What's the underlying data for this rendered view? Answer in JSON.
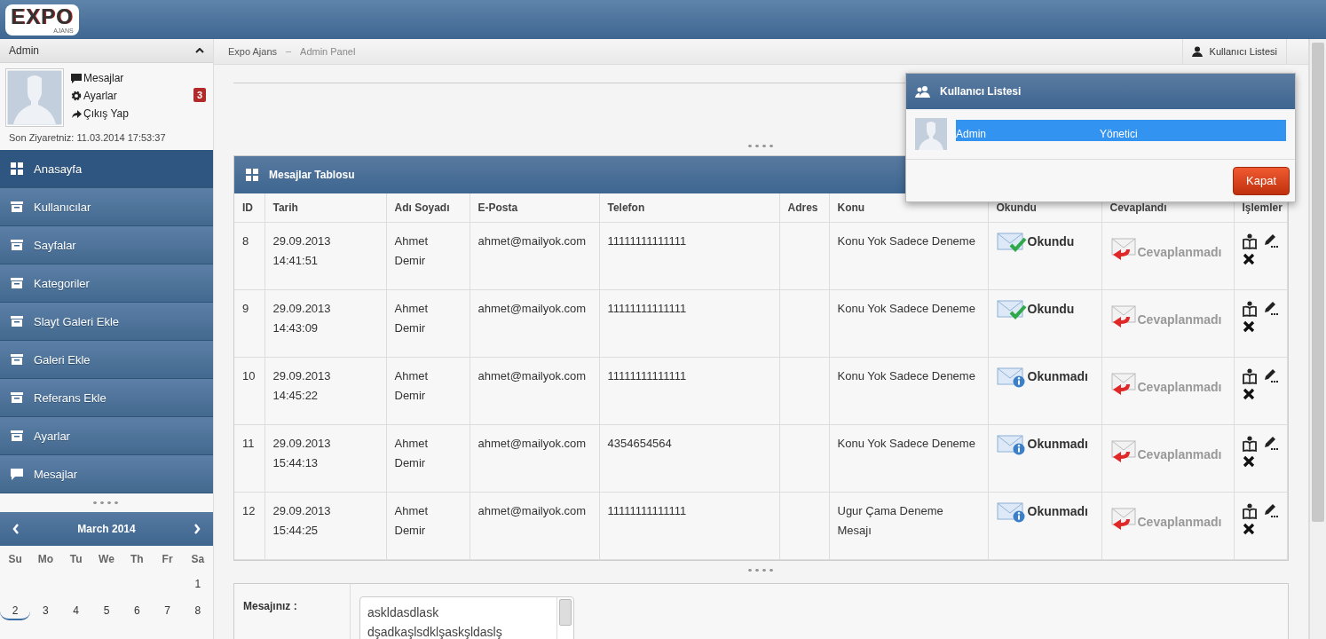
{
  "header": {
    "logo": "EXPO",
    "logo_sub": "AJANS"
  },
  "profile": {
    "title": "Admin",
    "links": [
      {
        "kind": "message",
        "label": "Mesajlar"
      },
      {
        "kind": "settings",
        "label": "Ayarlar"
      },
      {
        "kind": "logout",
        "label": "Çıkış Yap"
      }
    ],
    "badge": "3",
    "last_visit": "Son Ziyaretniz: 11.03.2014 17:53:37"
  },
  "sidebar": {
    "items": [
      {
        "label": "Anasayfa",
        "kind": "dashboard",
        "selected": true
      },
      {
        "label": "Kullanıcılar",
        "kind": "section",
        "selected": false
      },
      {
        "label": "Sayfalar",
        "kind": "section",
        "selected": false
      },
      {
        "label": "Kategoriler",
        "kind": "section",
        "selected": false
      },
      {
        "label": "Slayt Galeri Ekle",
        "kind": "section",
        "selected": false
      },
      {
        "label": "Galeri Ekle",
        "kind": "section",
        "selected": false
      },
      {
        "label": "Referans Ekle",
        "kind": "section",
        "selected": false
      },
      {
        "label": "Ayarlar",
        "kind": "section",
        "selected": false
      },
      {
        "label": "Mesajlar",
        "kind": "message",
        "selected": false
      }
    ]
  },
  "calendar": {
    "title": "March 2014",
    "weekdays": [
      "Su",
      "Mo",
      "Tu",
      "We",
      "Th",
      "Fr",
      "Sa"
    ],
    "weeks": [
      [
        {
          "day": "1",
          "selected": false
        }
      ],
      [
        {
          "day": "2",
          "selected": true
        },
        {
          "day": "3",
          "selected": false
        },
        {
          "day": "4",
          "selected": false
        },
        {
          "day": "5",
          "selected": false
        },
        {
          "day": "6",
          "selected": false
        },
        {
          "day": "7",
          "selected": false
        },
        {
          "day": "8",
          "selected": false
        }
      ]
    ]
  },
  "breadcrumb": [
    "Expo Ajans",
    "Admin Panel"
  ],
  "user_list_button": "Kullanıcı Listesi",
  "table": {
    "title": "Mesajlar Tablosu",
    "columns": [
      "ID",
      "Tarih",
      "Adı Soyadı",
      "E-Posta",
      "Telefon",
      "Adres",
      "Konu",
      "Okundu",
      "Cevaplandı",
      "İşlemler"
    ],
    "rows": [
      {
        "id": "8",
        "date": "29.09.2013",
        "time": "14:41:51",
        "name": "Ahmet Demir",
        "email": "ahmet@mailyok.com",
        "phone": "11111111111111",
        "subject": "Konu Yok Sadece Deneme",
        "read": true,
        "read_label": "Okundu",
        "answered": false,
        "answer_label": "Cevaplanmadı"
      },
      {
        "id": "9",
        "date": "29.09.2013",
        "time": "14:43:09",
        "name": "Ahmet Demir",
        "email": "ahmet@mailyok.com",
        "phone": "11111111111111",
        "subject": "Konu Yok Sadece Deneme",
        "read": true,
        "read_label": "Okundu",
        "answered": false,
        "answer_label": "Cevaplanmadı"
      },
      {
        "id": "10",
        "date": "29.09.2013",
        "time": "14:45:22",
        "name": "Ahmet Demir",
        "email": "ahmet@mailyok.com",
        "phone": "11111111111111",
        "subject": "Konu Yok Sadece Deneme",
        "read": false,
        "read_label": "Okunmadı",
        "answered": false,
        "answer_label": "Cevaplanmadı"
      },
      {
        "id": "11",
        "date": "29.09.2013",
        "time": "15:44:13",
        "name": "Ahmet Demir",
        "email": "ahmet@mailyok.com",
        "phone": "4354654564",
        "subject": "Konu Yok Sadece Deneme",
        "read": false,
        "read_label": "Okunmadı",
        "answered": false,
        "answer_label": "Cevaplanmadı"
      },
      {
        "id": "12",
        "date": "29.09.2013",
        "time": "15:44:25",
        "name": "Ahmet Demir",
        "email": "ahmet@mailyok.com",
        "phone": "11111111111111",
        "subject": "Ugur Çama Deneme Mesajı",
        "read": false,
        "read_label": "Okunmadı",
        "answered": false,
        "answer_label": "Cevaplanmadı"
      }
    ]
  },
  "message_form": {
    "label": "Mesajınız :",
    "value": "askldasdlask\ndşadkaşlsdklşaskşldaslş"
  },
  "popup": {
    "title": "Kullanıcı Listesi",
    "users": [
      {
        "name": "Admin",
        "role": "Yönetici",
        "selected": true
      }
    ],
    "close_button": "Kapat"
  }
}
